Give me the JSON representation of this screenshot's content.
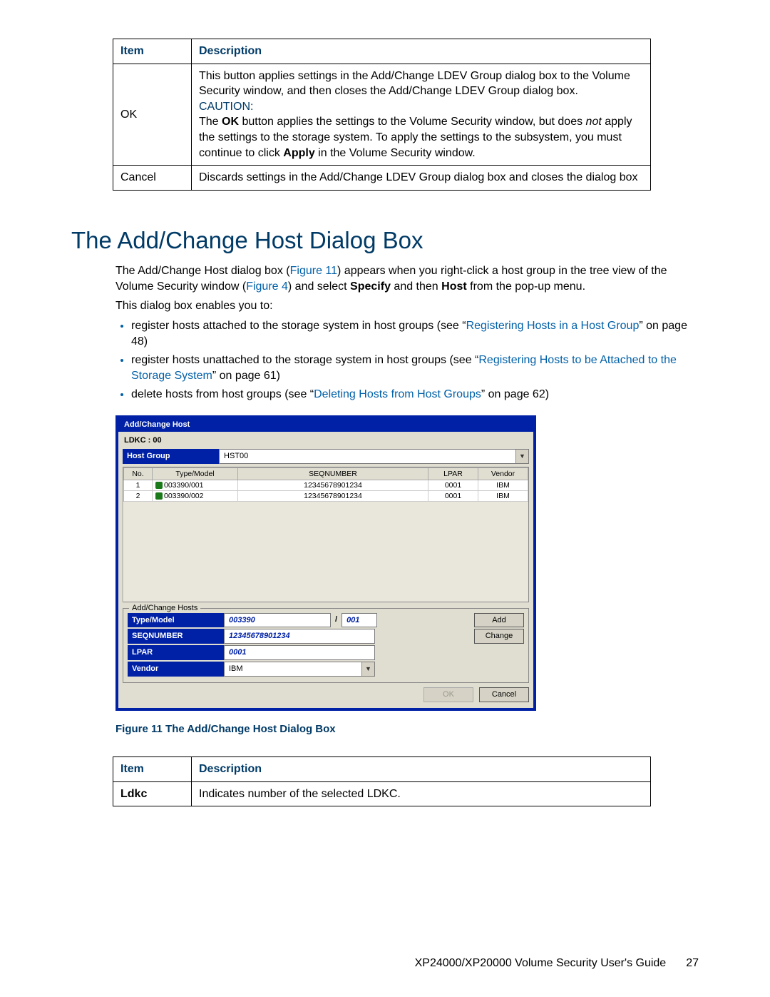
{
  "table1": {
    "head_item": "Item",
    "head_desc": "Description",
    "rows": [
      {
        "item": "OK",
        "desc1": "This button applies settings in the Add/Change LDEV Group dialog box to the Volume Security window, and then closes the Add/Change LDEV Group dialog box.",
        "caution_label": "CAUTION:",
        "desc2a": "The ",
        "desc2b": "OK",
        "desc2c": " button applies the settings to the Volume Security window, but does ",
        "desc2d": "not",
        "desc2e": " apply the settings to the storage system. To apply the settings to the subsystem, you must continue to click ",
        "desc2f": "Apply",
        "desc2g": " in the Volume Security window."
      },
      {
        "item": "Cancel",
        "desc": "Discards settings in the Add/Change LDEV Group dialog box and closes the dialog box"
      }
    ]
  },
  "section_title": "The Add/Change Host Dialog Box",
  "intro": {
    "p1a": "The Add/Change Host dialog box (",
    "p1_link1": "Figure 11",
    "p1b": ") appears when you right-click a host group in the tree view of the Volume Security window (",
    "p1_link2": "Figure 4",
    "p1c": ") and select ",
    "p1_bold1": "Specify",
    "p1d": " and then ",
    "p1_bold2": "Host",
    "p1e": " from the pop-up menu.",
    "p2": "This dialog box enables you to:"
  },
  "bullets": [
    {
      "pre": "register hosts attached to the storage system in host groups (see “",
      "link": "Registering Hosts in a Host Group",
      "post": "” on page 48)"
    },
    {
      "pre": "register hosts unattached to the storage system in host groups (see “",
      "link": "Registering Hosts to be Attached to the Storage System",
      "post": "” on page 61)"
    },
    {
      "pre": "delete hosts from host groups (see “",
      "link": "Deleting Hosts from Host Groups",
      "post": "” on page 62)"
    }
  ],
  "dialog": {
    "title": "Add/Change Host",
    "ldkc": "LDKC : 00",
    "hostgroup_label": "Host Group",
    "hostgroup_value": "HST00",
    "columns": {
      "no": "No.",
      "type": "Type/Model",
      "seq": "SEQNUMBER",
      "lpar": "LPAR",
      "vendor": "Vendor"
    },
    "rows": [
      {
        "no": "1",
        "type": "003390/001",
        "seq": "12345678901234",
        "lpar": "0001",
        "vendor": "IBM"
      },
      {
        "no": "2",
        "type": "003390/002",
        "seq": "12345678901234",
        "lpar": "0001",
        "vendor": "IBM"
      }
    ],
    "fieldset_label": "Add/Change Hosts",
    "fields": {
      "type_label": "Type/Model",
      "type_a": "003390",
      "type_b": "001",
      "seq_label": "SEQNUMBER",
      "seq_value": "12345678901234",
      "lpar_label": "LPAR",
      "lpar_value": "0001",
      "vendor_label": "Vendor",
      "vendor_value": "IBM"
    },
    "buttons": {
      "add": "Add",
      "change": "Change",
      "ok": "OK",
      "cancel": "Cancel"
    }
  },
  "fig_caption": "Figure 11 The Add/Change Host Dialog Box",
  "table2": {
    "head_item": "Item",
    "head_desc": "Description",
    "row_item": "Ldkc",
    "row_desc": "Indicates number of the selected LDKC."
  },
  "footer": {
    "text": "XP24000/XP20000 Volume Security User's Guide",
    "page": "27"
  }
}
